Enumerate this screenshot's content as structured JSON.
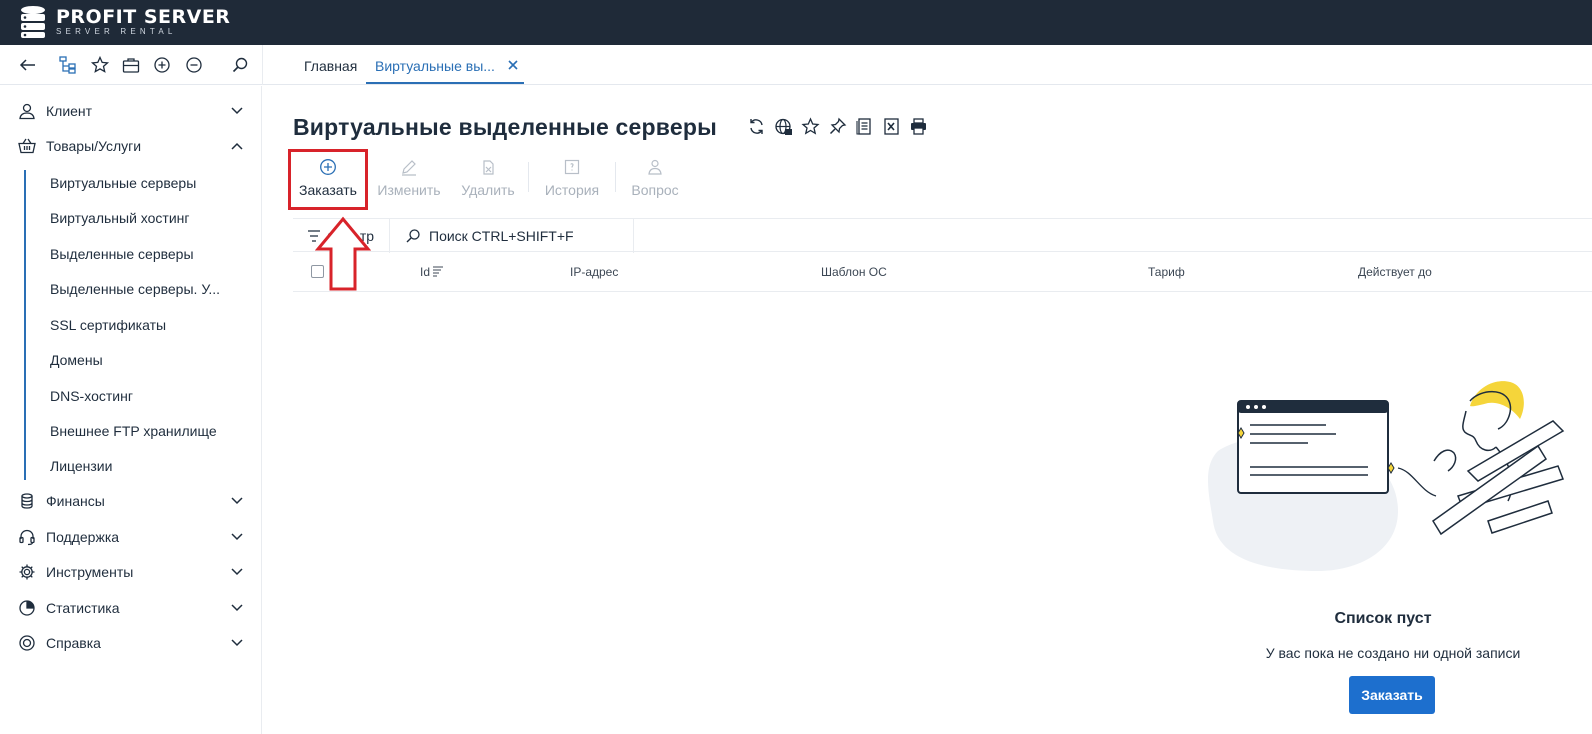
{
  "brand": {
    "name": "PROFIT SERVER",
    "tagline": "SERVER RENTAL"
  },
  "tabs": [
    {
      "label": "Главная",
      "active": false
    },
    {
      "label": "Виртуальные вы...",
      "active": true
    }
  ],
  "sidebar": {
    "groups": [
      {
        "label": "Клиент",
        "icon": "user-icon",
        "expanded": false
      },
      {
        "label": "Товары/Услуги",
        "icon": "basket-icon",
        "expanded": true
      },
      {
        "label": "Финансы",
        "icon": "coins-icon",
        "expanded": false
      },
      {
        "label": "Поддержка",
        "icon": "headset-icon",
        "expanded": false
      },
      {
        "label": "Инструменты",
        "icon": "gear-icon",
        "expanded": false
      },
      {
        "label": "Статистика",
        "icon": "pie-chart-icon",
        "expanded": false
      },
      {
        "label": "Справка",
        "icon": "lifebuoy-icon",
        "expanded": false
      }
    ],
    "items": [
      "Виртуальные серверы",
      "Виртуальный хостинг",
      "Выделенные серверы",
      "Выделенные серверы. У...",
      "SSL сертификаты",
      "Домены",
      "DNS-хостинг",
      "Внешнее FTP хранилище",
      "Лицензии"
    ]
  },
  "page": {
    "title": "Виртуальные выделенные серверы",
    "actions": [
      {
        "label": "Заказать",
        "enabled": true
      },
      {
        "label": "Изменить",
        "enabled": false
      },
      {
        "label": "Удалить",
        "enabled": false
      },
      {
        "label": "История",
        "enabled": false
      },
      {
        "label": "Вопрос",
        "enabled": false
      }
    ],
    "filter_label": "Фильтр",
    "search_placeholder": "Поиск CTRL+SHIFT+F",
    "columns": [
      "Id",
      "IP-адрес",
      "Шаблон ОС",
      "Тариф",
      "Действует до"
    ],
    "empty": {
      "title": "Список пуст",
      "subtitle": "У вас пока не создано ни одной записи",
      "button": "Заказать"
    }
  },
  "colors": {
    "topbar": "#1f2a38",
    "accent": "#2a6fb5",
    "primary_button": "#1d6fce",
    "highlight": "#d8232a"
  }
}
